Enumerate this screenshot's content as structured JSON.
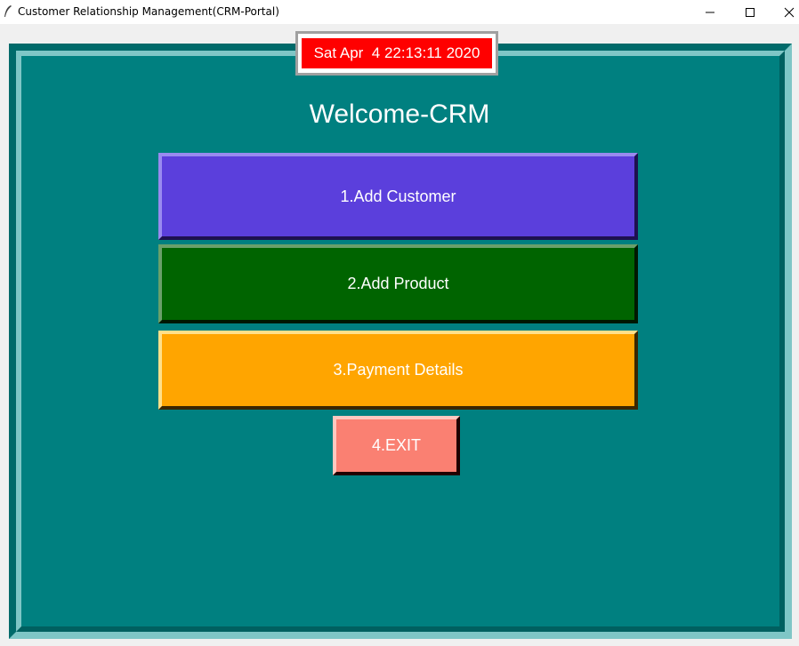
{
  "window": {
    "title": "Customer Relationship Management(CRM-Portal)",
    "icons": {
      "app": "feather-icon",
      "minimize": "minimize-icon",
      "maximize": "maximize-icon",
      "close": "close-icon"
    }
  },
  "clock": {
    "text": "Sat Apr  4 22:13:11 2020",
    "background": "#ff0000"
  },
  "heading": "Welcome-CRM",
  "menu": {
    "add_customer": "1.Add Customer",
    "add_product": "2.Add Product",
    "payment_details": "3.Payment Details",
    "exit": "4.EXIT"
  },
  "colors": {
    "background": "#008080",
    "add_customer": "#5b3fdc",
    "add_product": "#006400",
    "payment_details": "#ffa500",
    "exit": "#fa8072"
  }
}
